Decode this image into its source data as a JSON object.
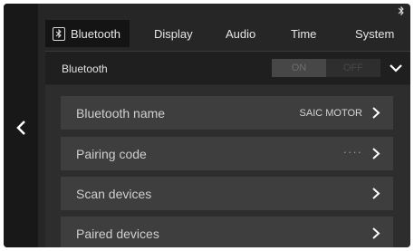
{
  "status_bar": {
    "bluetooth_icon": "bluetooth-icon"
  },
  "navigation": {
    "back_icon": "chevron-left-icon"
  },
  "tabs": [
    {
      "label": "Bluetooth",
      "icon": "bluetooth-icon",
      "active": true
    },
    {
      "label": "Display",
      "active": false
    },
    {
      "label": "Audio",
      "active": false
    },
    {
      "label": "Time",
      "active": false
    },
    {
      "label": "System",
      "active": false
    }
  ],
  "section": {
    "title": "Bluetooth",
    "toggle": {
      "on_label": "ON",
      "off_label": "OFF"
    },
    "collapse_icon": "chevron-down-icon"
  },
  "items": [
    {
      "label": "Bluetooth name",
      "value": "SAIC MOTOR"
    },
    {
      "label": "Pairing code",
      "value": "····"
    },
    {
      "label": "Scan devices",
      "value": ""
    },
    {
      "label": "Paired devices",
      "value": ""
    }
  ],
  "colors": {
    "background": "#262626",
    "row": "#3e3e3e",
    "text": "#cfcfcf"
  }
}
